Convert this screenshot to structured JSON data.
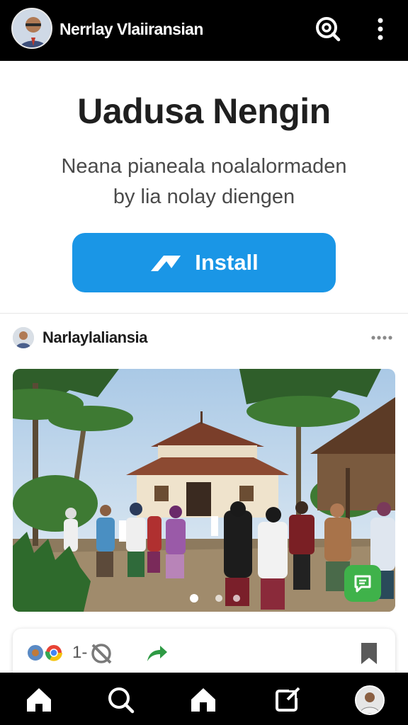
{
  "header": {
    "title": "Nerrlay Vlaiiransian",
    "search_icon": "search-icon",
    "more_icon": "more-vertical-icon"
  },
  "hero": {
    "title": "Uadusa Nengin",
    "subtitle_line1": "Neana pianeala noalalormaden",
    "subtitle_line2": "by lia nolay diengen",
    "install_label": "Install",
    "install_icon": "arrow-logo-icon"
  },
  "post": {
    "username": "Narlaylaliansia",
    "more_icon": "more-horizontal-icon",
    "carousel": {
      "count": 3,
      "active": 0
    },
    "chat_icon": "chat-icon"
  },
  "actions": {
    "count": "1-",
    "reaction_icons": [
      "globe-icon",
      "chrome-icon"
    ],
    "mute_icon": "mute-icon",
    "share_icon": "share-icon",
    "bookmark_icon": "bookmark-icon"
  },
  "nav": {
    "items": [
      "home-icon",
      "search-icon",
      "house-icon",
      "compose-icon",
      "profile-avatar"
    ]
  },
  "colors": {
    "accent": "#1a96e6",
    "bar": "#000000",
    "chat": "#3fb24a",
    "share": "#2e9a44"
  }
}
